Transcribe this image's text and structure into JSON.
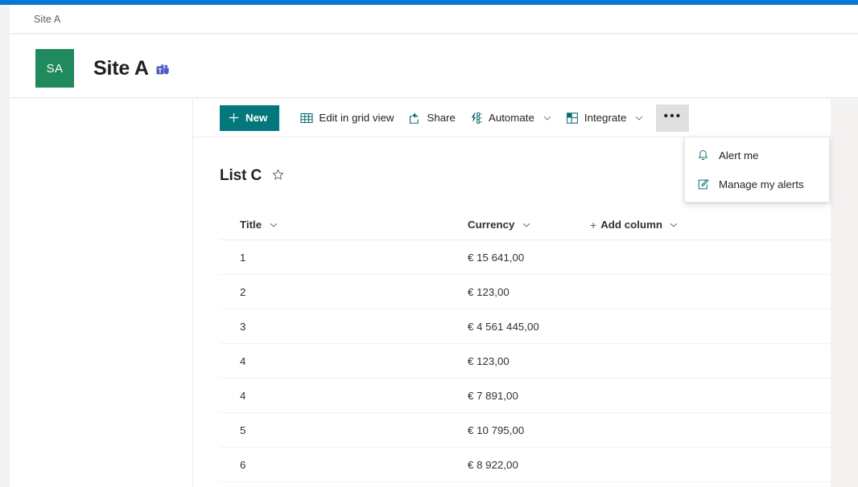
{
  "breadcrumb": {
    "label": "Site A"
  },
  "site_header": {
    "logo_initials": "SA",
    "logo_color": "#21895e",
    "title": "Site A",
    "teams_icon": "microsoft-teams-icon"
  },
  "command_bar": {
    "new": {
      "label": "New",
      "icon": "plus-icon",
      "background": "#03787c"
    },
    "edit_grid": {
      "label": "Edit in grid view",
      "icon": "grid-table-icon"
    },
    "share": {
      "label": "Share",
      "icon": "share-icon"
    },
    "automate": {
      "label": "Automate",
      "icon": "automate-flow-icon",
      "chevron": "chevron-down-icon"
    },
    "integrate": {
      "label": "Integrate",
      "icon": "integrate-grid-icon",
      "chevron": "chevron-down-icon"
    },
    "overflow": {
      "label": "•••",
      "icon": "more-ellipsis-icon"
    }
  },
  "context_menu": {
    "open": true,
    "items": [
      {
        "label": "Alert me",
        "icon": "bell-alert-icon"
      },
      {
        "label": "Manage my alerts",
        "icon": "edit-note-icon"
      }
    ]
  },
  "list": {
    "title": "List C",
    "favorite_icon": "star-outline-icon",
    "columns": [
      {
        "label": "Title",
        "chevron": "chevron-down-icon"
      },
      {
        "label": "Currency",
        "chevron": "chevron-down-icon"
      }
    ],
    "add_column": {
      "label": "Add column",
      "plus": "+",
      "chevron": "chevron-down-icon"
    },
    "rows": [
      {
        "title": "1",
        "currency": "€ 15 641,00"
      },
      {
        "title": "2",
        "currency": "€ 123,00"
      },
      {
        "title": "3",
        "currency": "€ 4 561 445,00"
      },
      {
        "title": "4",
        "currency": "€ 123,00"
      },
      {
        "title": "4",
        "currency": "€ 7 891,00"
      },
      {
        "title": "5",
        "currency": "€ 10 795,00"
      },
      {
        "title": "6",
        "currency": "€ 8 922,00"
      }
    ]
  },
  "theme": {
    "suite_bar": "#0078d4",
    "accent_teal": "#03787c",
    "icon_teal": "#0f6b70",
    "text_primary": "#242424",
    "border": "#edebe9"
  }
}
